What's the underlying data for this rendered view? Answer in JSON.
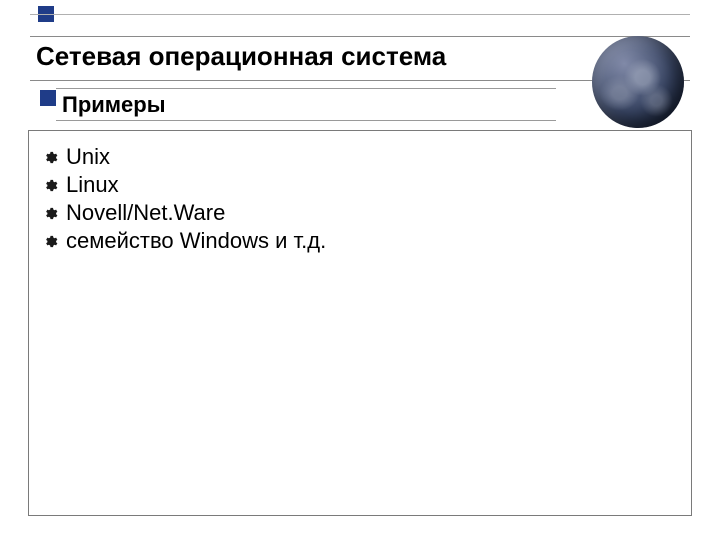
{
  "title": "Сетевая операционная система",
  "subtitle": "Примеры",
  "items": [
    "Unix",
    "Linux",
    "Novell/Net.Ware",
    "семейство Windows и т.д."
  ]
}
